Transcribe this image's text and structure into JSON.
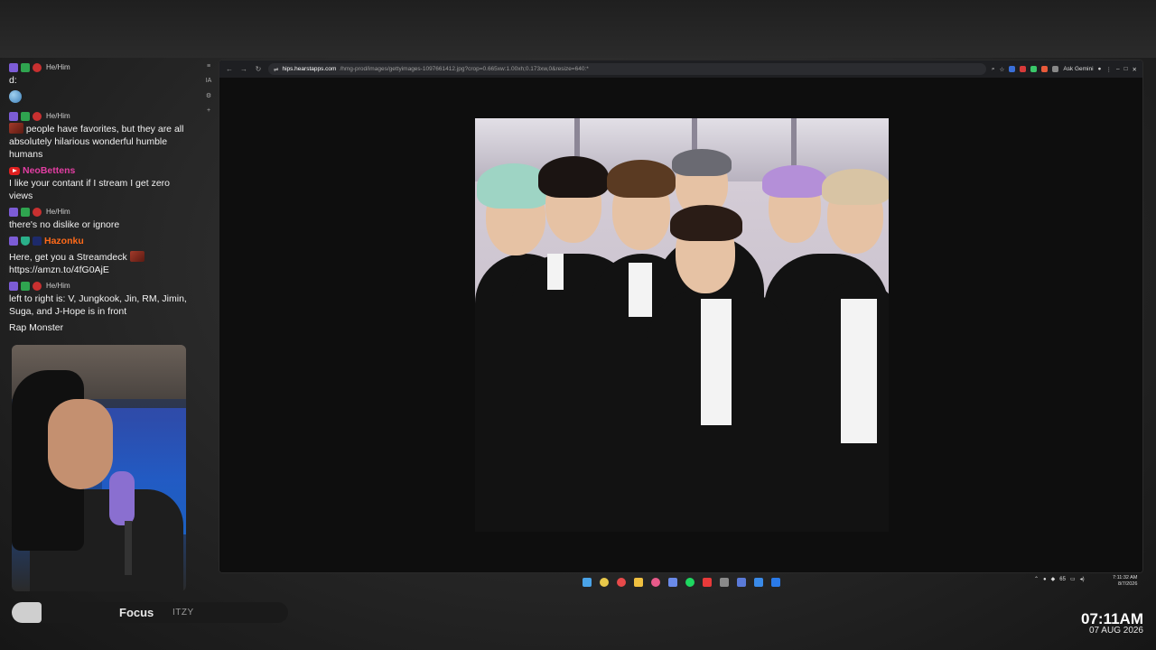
{
  "chat": {
    "messages": [
      {
        "pronoun": "He/Him",
        "username": "",
        "text": "d:"
      },
      {
        "pronoun": "",
        "username": "",
        "text": ""
      },
      {
        "pronoun": "He/Him",
        "username": "",
        "text": "people have favorites, but they are all absolutely hilarious wonderful humble humans"
      },
      {
        "pronoun": "",
        "username": "NeoBettens",
        "text": "I like your contant if I stream I get zero views"
      },
      {
        "pronoun": "He/Him",
        "username": "",
        "text": "there's no dislike or ignore"
      },
      {
        "pronoun": "",
        "username": "Hazonku",
        "text": "Here, get you a Streamdeck"
      },
      {
        "pronoun": "",
        "username": "",
        "text": "https://amzn.to/4fG0AjE"
      },
      {
        "pronoun": "He/Him",
        "username": "",
        "text": "left to right is: V, Jungkook, Jin, RM, Jimin, Suga, and J-Hope is in front"
      },
      {
        "pronoun": "",
        "username": "",
        "text": "Rap Monster"
      }
    ]
  },
  "browser": {
    "url_host": "hips.hearstapps.com",
    "url_path": "/hmg-prod/images/gettyimages-1097661412.jpg?crop=0.665xw:1.00xh;0.173xw,0&resize=640:*",
    "ask_gemini": "Ask Gemini"
  },
  "tray": {
    "temp": "65",
    "time": "7:11:32 AM",
    "date": "8/7/2026"
  },
  "player": {
    "title": "Focus",
    "artist": "ITZY"
  },
  "clock": {
    "time": "07:11AM",
    "date": "07 AUG 2026"
  },
  "colors": {
    "accent_purple": "#7c5cd6",
    "username_pink": "#e23ea2",
    "username_orange": "#ff6a1a",
    "username_red": "#8a0c0c"
  }
}
